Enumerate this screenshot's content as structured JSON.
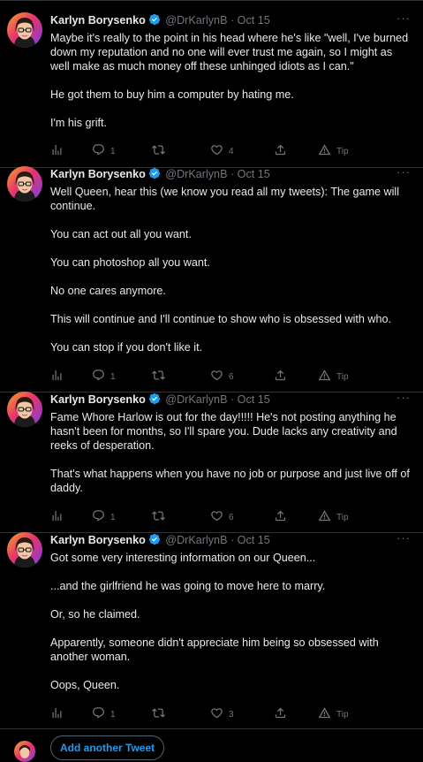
{
  "tweets": [
    {
      "name": "Karlyn Borysenko",
      "handle": "@DrKarlynB",
      "sep": "·",
      "date": "Oct 15",
      "paragraphs": [
        "Maybe it's really to the point in his head where he's like \"well, I've burned down my reputation and no one will ever trust me again, so I might as well make as much money off these unhinged idiots as I can.\"",
        "He got them to buy him a computer by hating me.",
        "I'm his grift."
      ],
      "replies": "1",
      "retweets": "",
      "likes": "4",
      "tip_label": "Tip"
    },
    {
      "name": "Karlyn Borysenko",
      "handle": "@DrKarlynB",
      "sep": "·",
      "date": "Oct 15",
      "paragraphs": [
        "Well Queen, hear this (we know you read all my tweets): The game will continue.",
        "You can act out all you want.",
        "You can photoshop all you want.",
        "No one cares anymore.",
        "This will continue and I'll continue to show who is obsessed with who.",
        "You can stop if you don't like it."
      ],
      "replies": "1",
      "retweets": "",
      "likes": "6",
      "tip_label": "Tip"
    },
    {
      "name": "Karlyn Borysenko",
      "handle": "@DrKarlynB",
      "sep": "·",
      "date": "Oct 15",
      "paragraphs": [
        "Fame Whore Harlow is out for the day!!!!! He's not posting anything he hasn't been for months, so I'll spare you. Dude lacks any creativity and reeks of desperation.",
        "That's what happens when you have no job or purpose and just live off of daddy."
      ],
      "replies": "1",
      "retweets": "",
      "likes": "6",
      "tip_label": "Tip"
    },
    {
      "name": "Karlyn Borysenko",
      "handle": "@DrKarlynB",
      "sep": "·",
      "date": "Oct 15",
      "paragraphs": [
        "Got some very interesting information on our Queen...",
        "...and the girlfriend he was going to move here to marry.",
        "Or, so he claimed.",
        "Apparently, someone didn't appreciate him being so obsessed with another woman.",
        "Oops, Queen."
      ],
      "replies": "1",
      "retweets": "",
      "likes": "3",
      "tip_label": "Tip"
    }
  ],
  "add_tweet_label": "Add another Tweet",
  "more_label": "···",
  "icons": {
    "analytics": "analytics-icon",
    "reply": "reply-icon",
    "retweet": "retweet-icon",
    "like": "heart-icon",
    "share": "share-icon",
    "tip": "tip-icon",
    "verified": "verified-badge-icon"
  },
  "colors": {
    "background": "#000000",
    "text": "#e7e9ea",
    "muted": "#71767b",
    "accent": "#1d9bf0",
    "divider": "#2f3336"
  }
}
